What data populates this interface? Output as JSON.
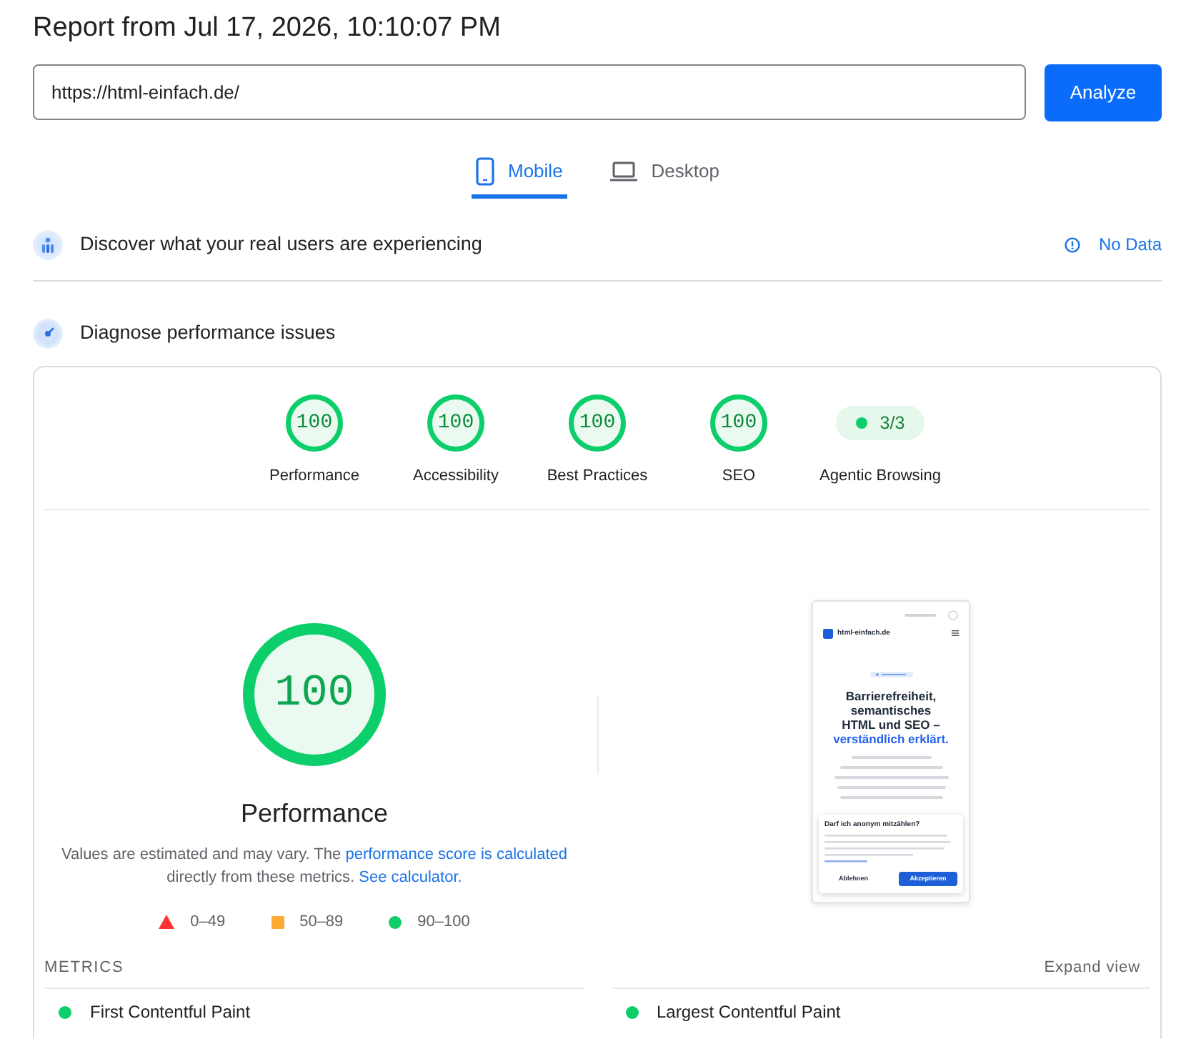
{
  "report": {
    "title": "Report from Jul 17, 2026, 10:10:07 PM"
  },
  "url_form": {
    "value": "https://html-einfach.de/",
    "button": "Analyze"
  },
  "device_tabs": [
    {
      "label": "Mobile",
      "kind": "phone",
      "selected": true
    },
    {
      "label": "Desktop",
      "kind": "laptop",
      "selected": false
    }
  ],
  "field_data": {
    "title": "Discover what your real users are experiencing",
    "status": "No Data"
  },
  "lab_data": {
    "title": "Diagnose performance issues",
    "categories": [
      {
        "kind": "gauge",
        "score": "100",
        "label": "Performance"
      },
      {
        "kind": "gauge",
        "score": "100",
        "label": "Accessibility"
      },
      {
        "kind": "gauge",
        "score": "100",
        "label": "Best Practices"
      },
      {
        "kind": "gauge",
        "score": "100",
        "label": "SEO"
      },
      {
        "kind": "pill",
        "score": "3/3",
        "label": "Agentic Browsing",
        "color": "#0cce6b"
      }
    ],
    "performance": {
      "score": "100",
      "title": "Performance",
      "description": [
        {
          "kind": "text",
          "text": "Values are estimated and may vary. The "
        },
        {
          "kind": "link",
          "text": "performance score is calculated"
        },
        {
          "kind": "text",
          "text": " directly from these metrics. "
        },
        {
          "kind": "link",
          "text": "See calculator."
        }
      ],
      "legend": [
        {
          "kind": "triangle",
          "range": "0–49",
          "color": "#ff3333"
        },
        {
          "kind": "square",
          "range": "50–89",
          "color": "#ffaa33"
        },
        {
          "kind": "circle",
          "range": "90–100",
          "color": "#0cce6b"
        }
      ]
    },
    "screenshot": {
      "site_name": "html-einfach.de",
      "headline": "Barrierefreiheit, semantisches HTML und SEO –",
      "headline_highlight": "verständlich erklärt.",
      "consent_title": "Darf ich anonym mitzählen?",
      "consent_buttons": [
        {
          "label": "Ablehnen",
          "kind": "secondary"
        },
        {
          "label": "Akzeptieren",
          "kind": "primary"
        }
      ]
    },
    "metrics": {
      "title": "METRICS",
      "toggle": "Expand view",
      "items": [
        {
          "name": "First Contentful Paint",
          "color": "#0cce6b"
        },
        {
          "name": "Largest Contentful Paint",
          "color": "#0cce6b"
        }
      ]
    }
  }
}
